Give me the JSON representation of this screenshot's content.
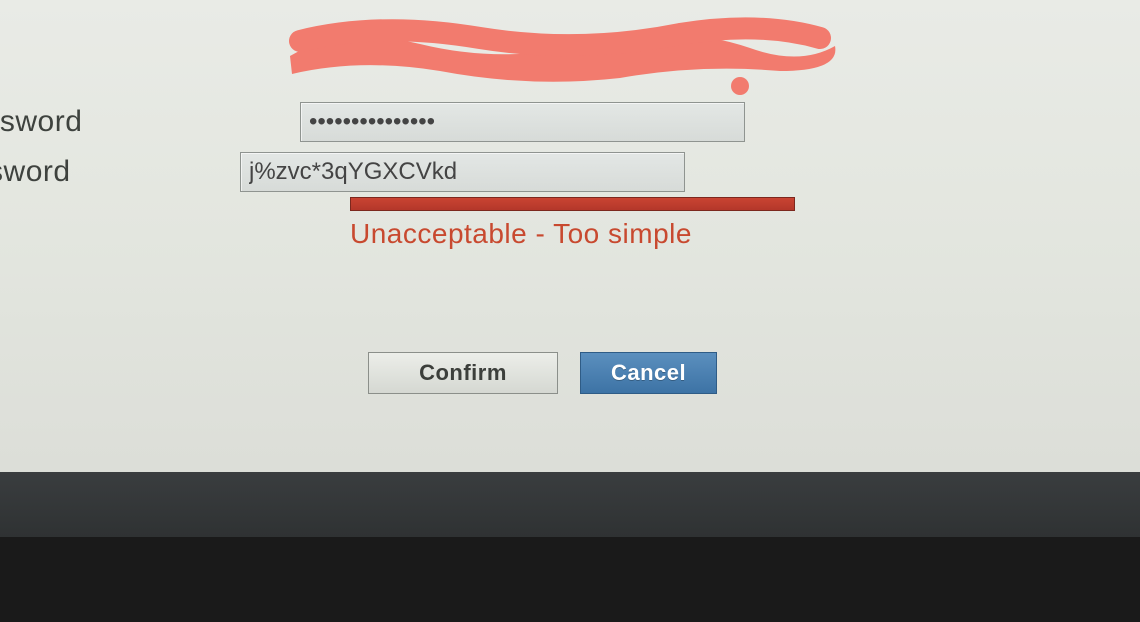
{
  "form": {
    "password_label": "password",
    "new_password_label": "ew password",
    "password_value": "•••••••••••••••",
    "new_password_value": "j%zvc*3qYGXCVkd"
  },
  "strength": {
    "message": "Unacceptable - Too simple",
    "color": "#c8492f"
  },
  "buttons": {
    "confirm": "Confirm",
    "cancel": "Cancel"
  }
}
